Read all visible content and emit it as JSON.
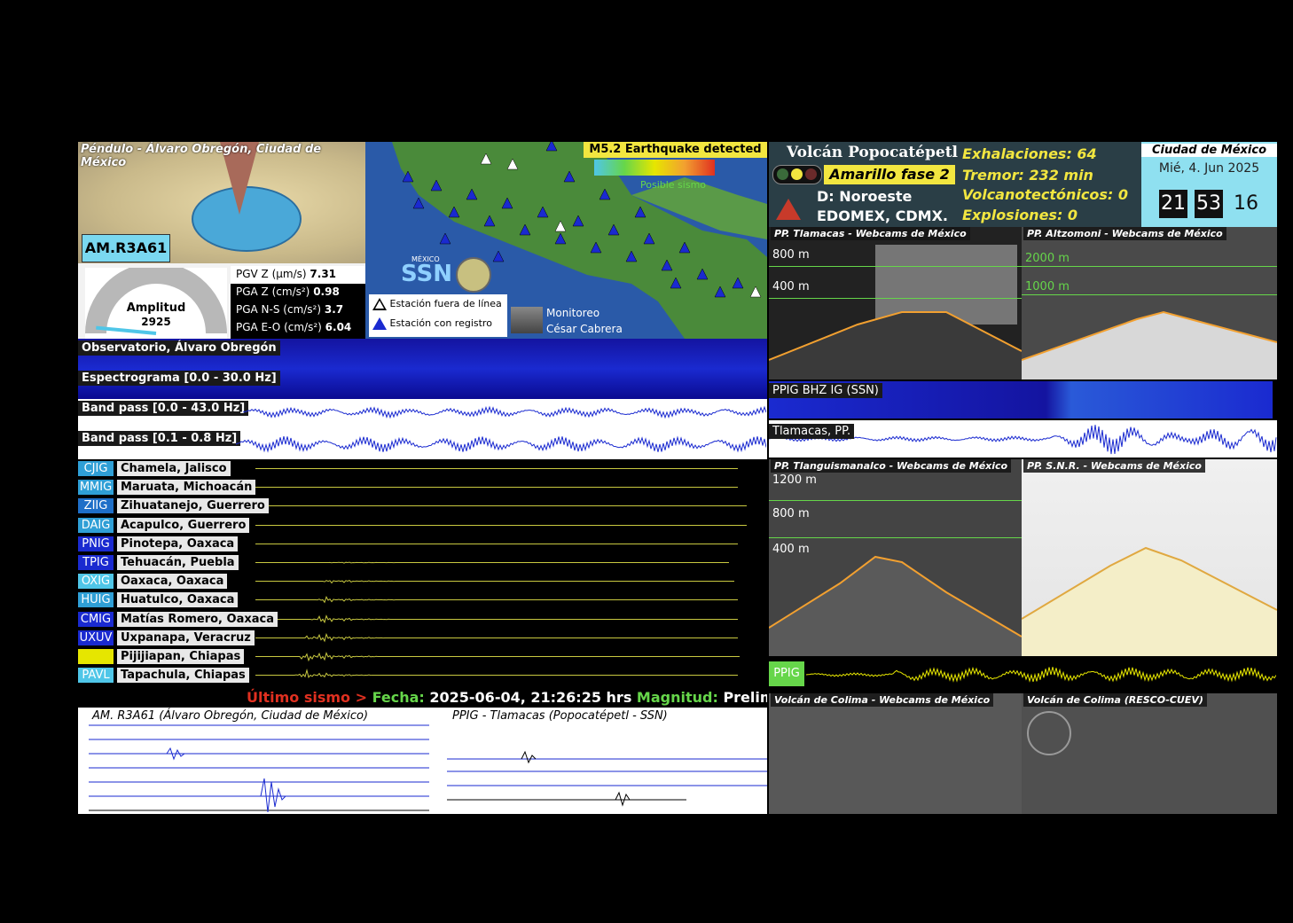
{
  "pendulum": {
    "title": "Péndulo - Álvaro Obregón, Ciudad de México",
    "station": "AM.R3A61",
    "gauge_label": "Amplitud",
    "gauge_value": "2925",
    "gauge_level": 0.03,
    "pgv_z_label": "PGV Z (μm/s)",
    "pgv_z": "7.31",
    "pga_z_label": "PGA Z (cm/s²)",
    "pga_z": "0.98",
    "pga_ns_label": "PGA N-S (cm/s²)",
    "pga_ns": "3.7",
    "pga_eo_label": "PGA E-O (cm/s²)",
    "pga_eo": "6.04"
  },
  "map": {
    "alert": "M5.2 Earthquake detected",
    "posible": "Posible sismo",
    "ssn_small": "MÉXICO",
    "ssn": "SSN",
    "legend_offline": "Estación fuera de línea",
    "legend_online": "Estación con registro",
    "monitor1": "Monitoreo",
    "monitor2": "César Cabrera"
  },
  "observatory": {
    "title": "Observatorio, Álvaro Obregón",
    "spectrogram": "Espectrograma [0.0 - 30.0 Hz]",
    "bandpass1": "Band pass [0.0 - 43.0 Hz]",
    "bandpass2": "Band pass [0.1 - 0.8 Hz]"
  },
  "stations": [
    {
      "code": "CJIG",
      "name": "Chamela, Jalisco",
      "color": "#2f9fd6",
      "amp": 0
    },
    {
      "code": "MMIG",
      "name": "Maruata, Michoacán",
      "color": "#2f9fd6",
      "amp": 0
    },
    {
      "code": "ZIIG",
      "name": "Zihuatanejo, Guerrero",
      "color": "#1e6fc8",
      "amp": 0
    },
    {
      "code": "DAIG",
      "name": "Acapulco, Guerrero",
      "color": "#2f9fd6",
      "amp": 0
    },
    {
      "code": "PNIG",
      "name": "Pinotepa, Oaxaca",
      "color": "#1a2ad0",
      "amp": 0
    },
    {
      "code": "TPIG",
      "name": "Tehuacán, Puebla",
      "color": "#1a2ad0",
      "amp": 1
    },
    {
      "code": "OXIG",
      "name": "Oaxaca, Oaxaca",
      "color": "#4fc6e8",
      "amp": 3
    },
    {
      "code": "HUIG",
      "name": "Huatulco, Oaxaca",
      "color": "#2f9fd6",
      "amp": 4
    },
    {
      "code": "CMIG",
      "name": "Matías Romero, Oaxaca",
      "color": "#1a2ad0",
      "amp": 6
    },
    {
      "code": "UXUV",
      "name": "Uxpanapa, Veracruz",
      "color": "#1a2ad0",
      "amp": 8
    },
    {
      "code": "",
      "name": "Pijijiapan, Chiapas",
      "color": "#e6e600",
      "amp": 10
    },
    {
      "code": "PAVL",
      "name": "Tapachula, Chiapas",
      "color": "#4fc6e8",
      "amp": 7
    }
  ],
  "last_quake": {
    "prefix": "Último sismo >",
    "fecha_label": "Fecha:",
    "fecha": "2025-06-04, 21:26:25 hrs",
    "mag_label": "Magnitud:",
    "mag": "Preliminar: M"
  },
  "bottom_plots": {
    "left_title": "AM. R3A61 (Álvaro Obregón, Ciudad de México)",
    "right_title": "PPIG - Tlamacas (Popocatépetl - SSN)"
  },
  "volcano": {
    "title": "Volcán Popocatépetl",
    "alert": "Amarillo fase 2",
    "direction": "D: Noroeste",
    "region": "EDOMEX, CDMX.",
    "exhalaciones": "Exhalaciones: 64",
    "tremor": "Tremor: 232 min",
    "vt": "Volcanotectónicos: 0",
    "explosiones": "Explosiones: 0"
  },
  "clock": {
    "city": "Ciudad de México",
    "date": "Mié, 4. Jun 2025",
    "hh": "21",
    "mm": "53",
    "ss": "16"
  },
  "webcams": {
    "tlamacas": "PP. Tlamacas - Webcams de México",
    "altzomoni": "PP. Altzomoni - Webcams de México",
    "tlanguismanalco": "PP. Tlanguismanalco - Webcams de México",
    "snr": "PP. S.N.R. - Webcams de México",
    "colima1": "Volcán de Colima - Webcams de México",
    "colima2": "Volcán de Colima (RESCO-CUEV)",
    "alt_800": "800 m",
    "alt_400": "400 m",
    "alt_2000": "2000 m",
    "alt_1000": "1000 m",
    "alt_1200": "1200 m",
    "alt_800b": "800 m",
    "alt_400b": "400 m"
  },
  "right_seis": {
    "ppig_bhz": "PPIG BHZ IG (SSN)",
    "tlamacas": "Tlamacas, PP.",
    "ppig": "PPIG"
  }
}
